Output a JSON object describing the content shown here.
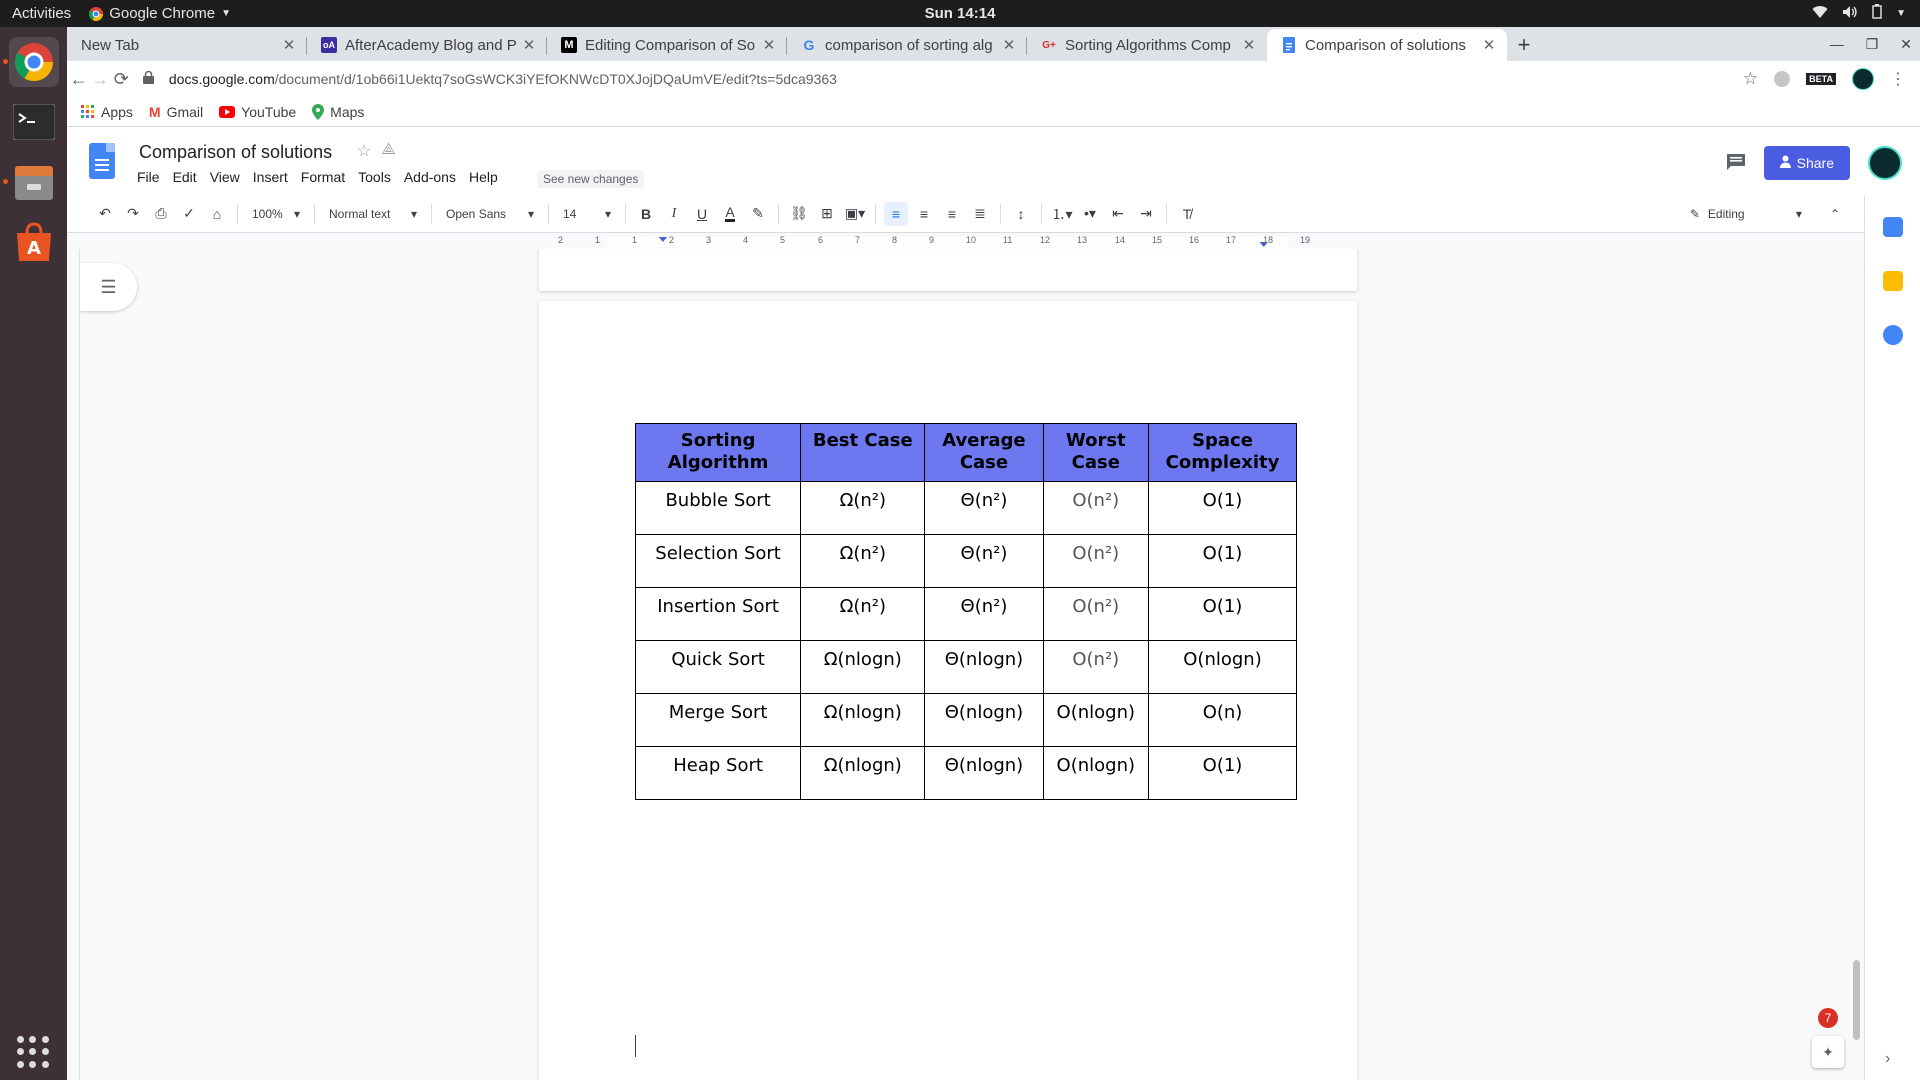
{
  "system": {
    "activities": "Activities",
    "app_name": "Google Chrome",
    "clock": "Sun 14:14"
  },
  "tabs": [
    {
      "label": "New Tab",
      "icon": "none"
    },
    {
      "label": "AfterAcademy Blog and P",
      "icon": "afteracademy-icon",
      "fav_text": "oA"
    },
    {
      "label": "Editing Comparison of So",
      "icon": "medium-icon",
      "fav_text": "M"
    },
    {
      "label": "comparison of sorting alg",
      "icon": "google-icon",
      "fav_text": "G"
    },
    {
      "label": "Sorting Algorithms Comp",
      "icon": "geeksforgeeks-icon",
      "fav_text": "G+"
    },
    {
      "label": "Comparison of solutions",
      "icon": "docs-icon",
      "fav_text": ""
    }
  ],
  "url": {
    "domain": "docs.google.com",
    "path": "/document/d/1ob66i1Uektq7soGsWCK3iYEfOKNWcDT0XJojDQaUmVE/edit?ts=5dca9363"
  },
  "bookmarks": [
    "Apps",
    "Gmail",
    "YouTube",
    "Maps"
  ],
  "document": {
    "title": "Comparison of solutions",
    "menus": [
      "File",
      "Edit",
      "View",
      "Insert",
      "Format",
      "Tools",
      "Add-ons",
      "Help"
    ],
    "see_new_changes": "See new changes",
    "share_label": "Share"
  },
  "format_toolbar": {
    "zoom": "100%",
    "style": "Normal text",
    "font": "Open Sans",
    "size": "14",
    "mode": "Editing"
  },
  "ruler_labels": [
    "2",
    "1",
    "1",
    "2",
    "3",
    "4",
    "5",
    "6",
    "7",
    "8",
    "9",
    "10",
    "11",
    "12",
    "13",
    "14",
    "15",
    "16",
    "17",
    "18",
    "19"
  ],
  "table": {
    "headers": [
      "Sorting Algorithm",
      "Best Case",
      "Average Case",
      "Worst Case",
      "Space Complexity"
    ],
    "rows": [
      [
        "Bubble Sort",
        "Ω(n²)",
        "Θ(n²)",
        "O(n²)",
        "O(1)"
      ],
      [
        "Selection Sort",
        "Ω(n²)",
        "Θ(n²)",
        "O(n²)",
        "O(1)"
      ],
      [
        "Insertion Sort",
        "Ω(n²)",
        "Θ(n²)",
        "O(n²)",
        "O(1)"
      ],
      [
        "Quick Sort",
        "Ω(nlogn)",
        "Θ(nlogn)",
        "O(n²)",
        "O(nlogn)"
      ],
      [
        "Merge Sort",
        "Ω(nlogn)",
        "Θ(nlogn)",
        "O(nlogn)",
        "O(n)"
      ],
      [
        "Heap Sort",
        "Ω(nlogn)",
        "Θ(nlogn)",
        "O(nlogn)",
        "O(1)"
      ]
    ]
  },
  "notification_count": "7",
  "colors": {
    "header_fill": "#6d78f0",
    "share_button": "#4a5ce0",
    "accent": "#1a73e8"
  }
}
